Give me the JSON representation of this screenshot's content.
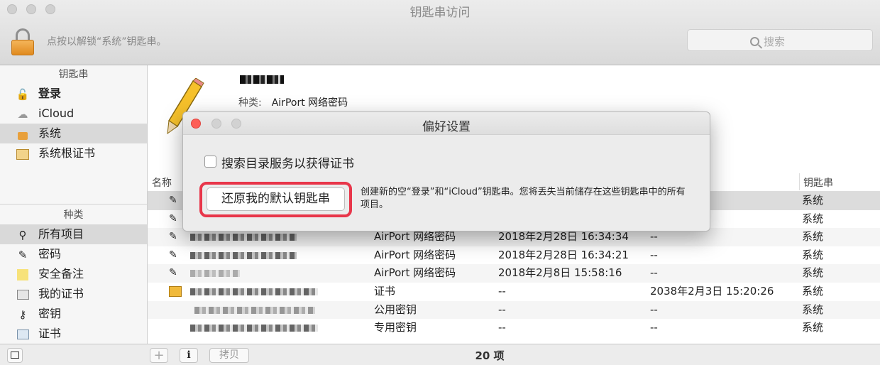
{
  "window": {
    "title": "钥匙串访问"
  },
  "toolbar": {
    "unlock_hint": "点按以解锁“系统”钥匙串。",
    "search_placeholder": "搜索"
  },
  "sidebar": {
    "keychains_header": "钥匙串",
    "keychains": [
      {
        "label": "登录",
        "icon": "lock-open-icon",
        "bold": true
      },
      {
        "label": "iCloud",
        "icon": "cloud-icon"
      },
      {
        "label": "系统",
        "icon": "lock-icon",
        "selected": true
      },
      {
        "label": "系统根证书",
        "icon": "cabinet-icon"
      }
    ],
    "categories_header": "种类",
    "categories": [
      {
        "label": "所有项目",
        "icon": "all-items-icon",
        "selected": true
      },
      {
        "label": "密码",
        "icon": "password-icon"
      },
      {
        "label": "安全备注",
        "icon": "secure-note-icon"
      },
      {
        "label": "我的证书",
        "icon": "my-certificate-icon"
      },
      {
        "label": "密钥",
        "icon": "key-icon"
      },
      {
        "label": "证书",
        "icon": "certificate-icon"
      }
    ]
  },
  "detail": {
    "kind_label": "种类:",
    "kind_value": "AirPort 网络密码"
  },
  "table": {
    "columns": {
      "name": "名称",
      "keychain": "钥匙串"
    },
    "rows": [
      {
        "kind": "",
        "modified": "",
        "expires": "",
        "keychain": "系统"
      },
      {
        "kind": "",
        "modified": "",
        "expires": "",
        "keychain": "系统"
      },
      {
        "kind": "AirPort 网络密码",
        "modified": "2018年2月28日 16:34:34",
        "expires": "--",
        "keychain": "系统"
      },
      {
        "kind": "AirPort 网络密码",
        "modified": "2018年2月28日 16:34:21",
        "expires": "--",
        "keychain": "系统"
      },
      {
        "kind": "AirPort 网络密码",
        "modified": "2018年2月8日 15:58:16",
        "expires": "--",
        "keychain": "系统"
      },
      {
        "kind": "证书",
        "modified": "--",
        "expires": "2038年2月3日 15:20:26",
        "keychain": "系统"
      },
      {
        "kind": "公用密钥",
        "modified": "--",
        "expires": "--",
        "keychain": "系统"
      },
      {
        "kind": "专用密钥",
        "modified": "--",
        "expires": "--",
        "keychain": "系统"
      }
    ]
  },
  "footer": {
    "copy_label": "拷贝",
    "info_label": "i",
    "item_count": "20 项"
  },
  "dialog": {
    "title": "偏好设置",
    "checkbox_label": "搜索目录服务以获得证书",
    "checkbox_checked": false,
    "reset_button": "还原我的默认钥匙串",
    "reset_description": "创建新的空“登录”和“iCloud”钥匙串。您将丢失当前储存在这些钥匙串中的所有项目。",
    "highlight_color": "#e8364a"
  }
}
